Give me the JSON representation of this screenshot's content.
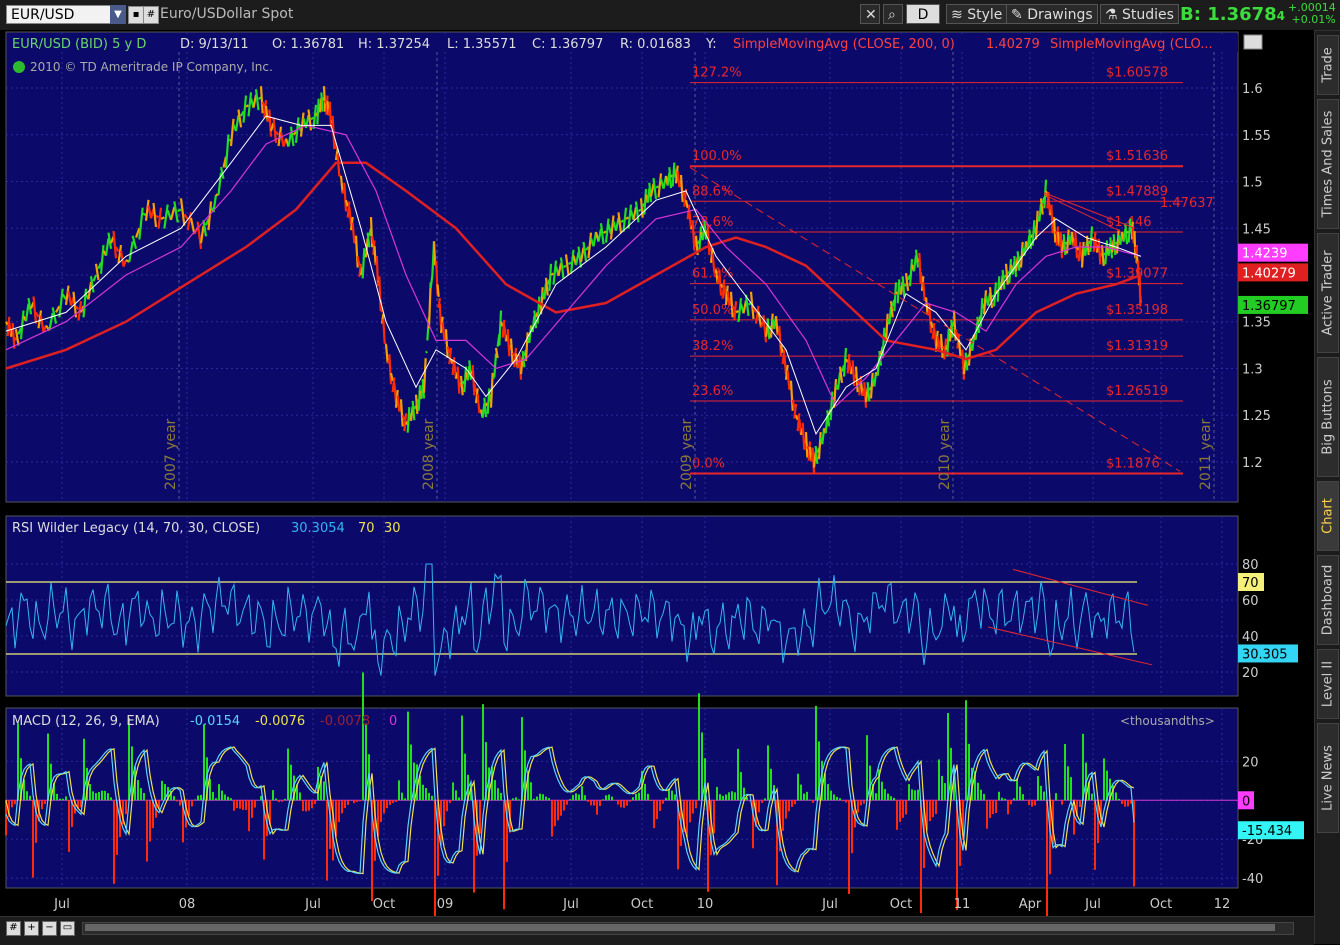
{
  "toolbar": {
    "symbol": "EUR/USD",
    "description": "Euro/USDollar Spot",
    "period_btn": "D",
    "style_btn": "Style",
    "drawings_btn": "Drawings",
    "studies_btn": "Studies",
    "bid_prefix": "B:",
    "bid": "1.3678",
    "bid_small": "4",
    "change_abs": "+.00014",
    "change_pct": "+0.01%"
  },
  "side_tabs": [
    "Trade",
    "Times And Sales",
    "Active Trader",
    "Big Buttons",
    "Chart",
    "Dashboard",
    "Level II",
    "Live News"
  ],
  "active_tab": "Chart",
  "colors": {
    "background": "#0b0a6a",
    "grid": "#2a2a9a",
    "fib": "#e8262e",
    "sma200": "#e02020",
    "sma_fast": "#ffffff",
    "sma_mid": "#d636d6",
    "rsi": "#33b5f5",
    "macd": "#5ad3ff",
    "signal": "#f0e14a",
    "bull": "#22dd22",
    "bear": "#ff2a0a"
  },
  "price_header": {
    "title": "EUR/USD (BID) 5 y D",
    "date": "D: 9/13/11",
    "open": "O: 1.36781",
    "high": "H: 1.37254",
    "low": "L: 1.35571",
    "close": "C: 1.36797",
    "range": "R: 0.01683",
    "y": "Y:",
    "sma1": "SimpleMovingAvg (CLOSE, 200, 0)",
    "sma1_val": "1.40279",
    "sma2": "SimpleMovingAvg (CLO...",
    "copyright": "2010 © TD Ameritrade IP Company, Inc."
  },
  "rsi_header": {
    "title": "RSI Wilder Legacy (14, 70, 30, CLOSE)",
    "value": "30.3054",
    "ob": "70",
    "os": "30"
  },
  "macd_header": {
    "title": "MACD (12, 26, 9, EMA)",
    "value": "-0.0154",
    "avg": "-0.0076",
    "diff": "-0.0078",
    "zero": "0",
    "units": "<thousandths>"
  },
  "chart_data": [
    {
      "type": "line",
      "panel": "price",
      "y_ticks": [
        1.2,
        1.25,
        1.3,
        1.35,
        1.4,
        1.45,
        1.5,
        1.55,
        1.6
      ],
      "ylim": [
        1.17,
        1.63
      ],
      "x_ticks": [
        "Jul",
        "08",
        "Jul",
        "Oct",
        "09",
        "Jul",
        "Oct",
        "10",
        "Jul",
        "Oct",
        "11",
        "Apr",
        "Jul",
        "Oct",
        "12"
      ],
      "year_labels": [
        "2007 year",
        "2008 year",
        "2009 year",
        "2010 year",
        "2011 year"
      ],
      "price_path": [
        [
          0,
          1.35
        ],
        [
          10,
          1.33
        ],
        [
          25,
          1.37
        ],
        [
          40,
          1.34
        ],
        [
          60,
          1.38
        ],
        [
          75,
          1.36
        ],
        [
          90,
          1.4
        ],
        [
          105,
          1.44
        ],
        [
          120,
          1.41
        ],
        [
          140,
          1.47
        ],
        [
          155,
          1.46
        ],
        [
          175,
          1.47
        ],
        [
          195,
          1.44
        ],
        [
          210,
          1.48
        ],
        [
          225,
          1.55
        ],
        [
          240,
          1.58
        ],
        [
          255,
          1.59
        ],
        [
          265,
          1.56
        ],
        [
          280,
          1.54
        ],
        [
          295,
          1.56
        ],
        [
          310,
          1.57
        ],
        [
          318,
          1.59
        ],
        [
          325,
          1.57
        ],
        [
          335,
          1.5
        ],
        [
          345,
          1.46
        ],
        [
          355,
          1.4
        ],
        [
          365,
          1.45
        ],
        [
          372,
          1.4
        ],
        [
          380,
          1.32
        ],
        [
          390,
          1.27
        ],
        [
          400,
          1.24
        ],
        [
          410,
          1.26
        ],
        [
          418,
          1.28
        ],
        [
          428,
          1.43
        ],
        [
          435,
          1.35
        ],
        [
          445,
          1.31
        ],
        [
          455,
          1.28
        ],
        [
          465,
          1.3
        ],
        [
          475,
          1.25
        ],
        [
          485,
          1.27
        ],
        [
          495,
          1.35
        ],
        [
          505,
          1.32
        ],
        [
          515,
          1.3
        ],
        [
          525,
          1.34
        ],
        [
          535,
          1.37
        ],
        [
          545,
          1.4
        ],
        [
          560,
          1.41
        ],
        [
          575,
          1.42
        ],
        [
          590,
          1.44
        ],
        [
          605,
          1.45
        ],
        [
          620,
          1.46
        ],
        [
          635,
          1.47
        ],
        [
          645,
          1.49
        ],
        [
          660,
          1.5
        ],
        [
          670,
          1.51
        ],
        [
          680,
          1.48
        ],
        [
          690,
          1.43
        ],
        [
          700,
          1.45
        ],
        [
          710,
          1.4
        ],
        [
          720,
          1.38
        ],
        [
          730,
          1.36
        ],
        [
          745,
          1.37
        ],
        [
          760,
          1.34
        ],
        [
          770,
          1.35
        ],
        [
          780,
          1.3
        ],
        [
          790,
          1.25
        ],
        [
          800,
          1.22
        ],
        [
          808,
          1.2
        ],
        [
          818,
          1.23
        ],
        [
          828,
          1.27
        ],
        [
          840,
          1.31
        ],
        [
          850,
          1.29
        ],
        [
          860,
          1.27
        ],
        [
          870,
          1.29
        ],
        [
          880,
          1.34
        ],
        [
          890,
          1.38
        ],
        [
          900,
          1.39
        ],
        [
          912,
          1.42
        ],
        [
          920,
          1.37
        ],
        [
          930,
          1.33
        ],
        [
          940,
          1.32
        ],
        [
          948,
          1.35
        ],
        [
          958,
          1.3
        ],
        [
          968,
          1.33
        ],
        [
          978,
          1.37
        ],
        [
          990,
          1.38
        ],
        [
          1000,
          1.4
        ],
        [
          1010,
          1.41
        ],
        [
          1020,
          1.43
        ],
        [
          1030,
          1.45
        ],
        [
          1040,
          1.49
        ],
        [
          1048,
          1.45
        ],
        [
          1056,
          1.43
        ],
        [
          1066,
          1.44
        ],
        [
          1076,
          1.42
        ],
        [
          1086,
          1.44
        ],
        [
          1096,
          1.42
        ],
        [
          1106,
          1.43
        ],
        [
          1116,
          1.44
        ],
        [
          1126,
          1.45
        ],
        [
          1131,
          1.42
        ],
        [
          1135,
          1.37
        ]
      ],
      "sma_fast_path": [
        [
          0,
          1.34
        ],
        [
          60,
          1.36
        ],
        [
          120,
          1.42
        ],
        [
          175,
          1.45
        ],
        [
          225,
          1.52
        ],
        [
          260,
          1.57
        ],
        [
          295,
          1.56
        ],
        [
          325,
          1.56
        ],
        [
          355,
          1.45
        ],
        [
          380,
          1.35
        ],
        [
          410,
          1.28
        ],
        [
          430,
          1.32
        ],
        [
          460,
          1.3
        ],
        [
          480,
          1.27
        ],
        [
          510,
          1.31
        ],
        [
          550,
          1.39
        ],
        [
          600,
          1.43
        ],
        [
          650,
          1.48
        ],
        [
          680,
          1.49
        ],
        [
          710,
          1.42
        ],
        [
          745,
          1.37
        ],
        [
          780,
          1.32
        ],
        [
          810,
          1.23
        ],
        [
          840,
          1.28
        ],
        [
          870,
          1.3
        ],
        [
          900,
          1.38
        ],
        [
          930,
          1.36
        ],
        [
          960,
          1.32
        ],
        [
          990,
          1.38
        ],
        [
          1030,
          1.44
        ],
        [
          1050,
          1.46
        ],
        [
          1080,
          1.44
        ],
        [
          1110,
          1.43
        ],
        [
          1135,
          1.42
        ]
      ],
      "sma_mid_path": [
        [
          0,
          1.32
        ],
        [
          60,
          1.35
        ],
        [
          120,
          1.4
        ],
        [
          175,
          1.43
        ],
        [
          225,
          1.49
        ],
        [
          260,
          1.54
        ],
        [
          300,
          1.56
        ],
        [
          340,
          1.55
        ],
        [
          370,
          1.49
        ],
        [
          400,
          1.4
        ],
        [
          430,
          1.33
        ],
        [
          460,
          1.33
        ],
        [
          490,
          1.3
        ],
        [
          520,
          1.31
        ],
        [
          560,
          1.36
        ],
        [
          600,
          1.41
        ],
        [
          650,
          1.46
        ],
        [
          690,
          1.47
        ],
        [
          720,
          1.43
        ],
        [
          760,
          1.39
        ],
        [
          800,
          1.33
        ],
        [
          830,
          1.26
        ],
        [
          860,
          1.29
        ],
        [
          890,
          1.33
        ],
        [
          920,
          1.37
        ],
        [
          950,
          1.36
        ],
        [
          980,
          1.34
        ],
        [
          1010,
          1.39
        ],
        [
          1040,
          1.42
        ],
        [
          1070,
          1.43
        ],
        [
          1100,
          1.43
        ],
        [
          1135,
          1.42
        ]
      ],
      "sma200_path": [
        [
          0,
          1.3
        ],
        [
          60,
          1.32
        ],
        [
          120,
          1.35
        ],
        [
          180,
          1.39
        ],
        [
          240,
          1.43
        ],
        [
          290,
          1.47
        ],
        [
          330,
          1.52
        ],
        [
          360,
          1.52
        ],
        [
          400,
          1.49
        ],
        [
          450,
          1.45
        ],
        [
          500,
          1.39
        ],
        [
          550,
          1.36
        ],
        [
          600,
          1.37
        ],
        [
          650,
          1.4
        ],
        [
          700,
          1.43
        ],
        [
          730,
          1.44
        ],
        [
          760,
          1.43
        ],
        [
          800,
          1.41
        ],
        [
          840,
          1.37
        ],
        [
          880,
          1.33
        ],
        [
          930,
          1.32
        ],
        [
          960,
          1.31
        ],
        [
          990,
          1.32
        ],
        [
          1030,
          1.36
        ],
        [
          1070,
          1.38
        ],
        [
          1110,
          1.39
        ],
        [
          1135,
          1.4
        ]
      ],
      "fib_levels": [
        {
          "pct": "127.2%",
          "value": "$1.60578",
          "y": 1.60578
        },
        {
          "pct": "100.0%",
          "value": "$1.51636",
          "y": 1.51636
        },
        {
          "pct": "88.6%",
          "value": "$1.47889",
          "y": 1.47889
        },
        {
          "pct": "78.6%",
          "value": "$1.446",
          "y": 1.446
        },
        {
          "pct": "61.8%",
          "value": "$1.39077",
          "y": 1.39077
        },
        {
          "pct": "50.0%",
          "value": "$1.35198",
          "y": 1.35198
        },
        {
          "pct": "38.2%",
          "value": "$1.31319",
          "y": 1.31319
        },
        {
          "pct": "23.6%",
          "value": "$1.26519",
          "y": 1.26519
        },
        {
          "pct": "0.0%",
          "value": "$1.1876",
          "y": 1.1876
        }
      ],
      "annotation": "1.47637",
      "price_tags": [
        {
          "value": "1.4239",
          "color": "#ff3cff"
        },
        {
          "value": "1.40279",
          "color": "#e02020"
        },
        {
          "value": "1.36797",
          "color": "#22cc22"
        }
      ]
    },
    {
      "type": "line",
      "panel": "rsi",
      "y_ticks": [
        20,
        40,
        60,
        80
      ],
      "ylim": [
        10,
        90
      ],
      "levels": [
        70,
        30
      ],
      "last": "30.305",
      "level_tag": "70"
    },
    {
      "type": "line",
      "panel": "macd",
      "y_ticks": [
        -40,
        -20,
        0,
        20
      ],
      "ylim": [
        -42,
        32
      ],
      "last_macd": "-15.434",
      "zero_tag": "0"
    }
  ]
}
